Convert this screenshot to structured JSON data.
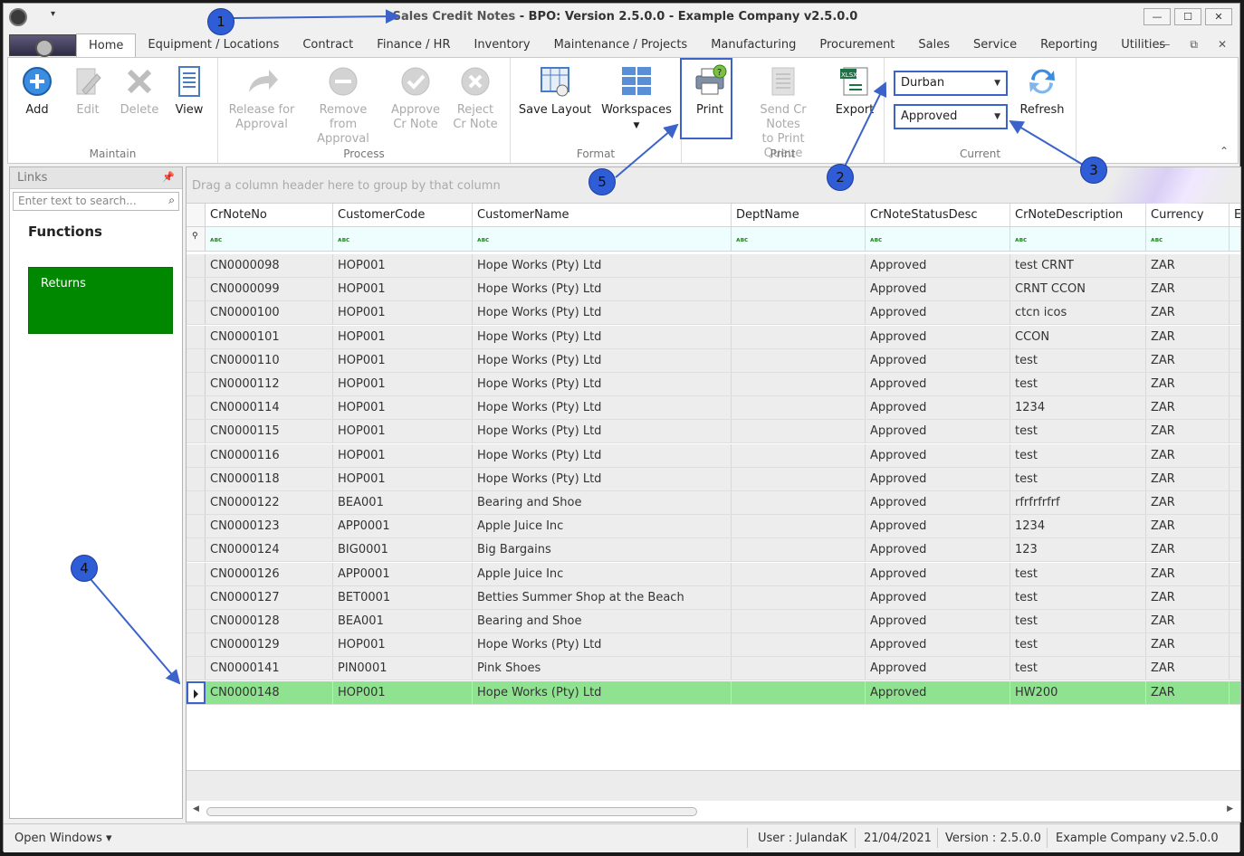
{
  "title": {
    "part1": "Sales Credit Notes",
    "part2": " - BPO: Version 2.5.0.0 - Example Company v2.5.0.0"
  },
  "window_controls": [
    "—",
    "☐",
    "✕"
  ],
  "tabs": [
    "Home",
    "Equipment / Locations",
    "Contract",
    "Finance / HR",
    "Inventory",
    "Maintenance / Projects",
    "Manufacturing",
    "Procurement",
    "Sales",
    "Service",
    "Reporting",
    "Utilities"
  ],
  "tab_controls": [
    "—",
    "⧉",
    "✕"
  ],
  "ribbon": {
    "maintain": {
      "label": "Maintain",
      "add": "Add",
      "edit": "Edit",
      "delete": "Delete",
      "view": "View"
    },
    "process": {
      "label": "Process",
      "release_1": "Release for",
      "release_2": "Approval",
      "remove_1": "Remove from",
      "remove_2": "Approval",
      "approve_1": "Approve",
      "approve_2": "Cr Note",
      "reject_1": "Reject",
      "reject_2": "Cr Note"
    },
    "format": {
      "label": "Format",
      "save_layout": "Save Layout",
      "workspaces": "Workspaces"
    },
    "print": {
      "label": "Print",
      "print": "Print",
      "send_1": "Send Cr Notes",
      "send_2": "to Print Queue",
      "export": "Export"
    },
    "current": {
      "label": "Current",
      "site": "Durban",
      "status": "Approved",
      "refresh": "Refresh"
    }
  },
  "links": {
    "title": "Links",
    "search_placeholder": "Enter text to search...",
    "functions": "Functions",
    "returns": "Returns"
  },
  "grid": {
    "group_hint": "Drag a column header here to group by that column",
    "columns": [
      "CrNoteNo",
      "CustomerCode",
      "CustomerName",
      "DeptName",
      "CrNoteStatusDesc",
      "CrNoteDescription",
      "Currency",
      "E"
    ],
    "rows": [
      [
        "CN0000098",
        "HOP001",
        "Hope Works (Pty) Ltd",
        "",
        "Approved",
        "test CRNT",
        "ZAR"
      ],
      [
        "CN0000099",
        "HOP001",
        "Hope Works (Pty) Ltd",
        "",
        "Approved",
        "CRNT CCON",
        "ZAR"
      ],
      [
        "CN0000100",
        "HOP001",
        "Hope Works (Pty) Ltd",
        "",
        "Approved",
        "ctcn icos",
        "ZAR"
      ],
      [
        "CN0000101",
        "HOP001",
        "Hope Works (Pty) Ltd",
        "",
        "Approved",
        "CCON",
        "ZAR"
      ],
      [
        "CN0000110",
        "HOP001",
        "Hope Works (Pty) Ltd",
        "",
        "Approved",
        "test",
        "ZAR"
      ],
      [
        "CN0000112",
        "HOP001",
        "Hope Works (Pty) Ltd",
        "",
        "Approved",
        "test",
        "ZAR"
      ],
      [
        "CN0000114",
        "HOP001",
        "Hope Works (Pty) Ltd",
        "",
        "Approved",
        "1234",
        "ZAR"
      ],
      [
        "CN0000115",
        "HOP001",
        "Hope Works (Pty) Ltd",
        "",
        "Approved",
        "test",
        "ZAR"
      ],
      [
        "CN0000116",
        "HOP001",
        "Hope Works (Pty) Ltd",
        "",
        "Approved",
        "test",
        "ZAR"
      ],
      [
        "CN0000118",
        "HOP001",
        "Hope Works (Pty) Ltd",
        "",
        "Approved",
        "test",
        "ZAR"
      ],
      [
        "CN0000122",
        "BEA001",
        "Bearing and Shoe",
        "",
        "Approved",
        "rfrfrfrfrf",
        "ZAR"
      ],
      [
        "CN0000123",
        "APP0001",
        "Apple Juice Inc",
        "",
        "Approved",
        "1234",
        "ZAR"
      ],
      [
        "CN0000124",
        "BIG0001",
        "Big Bargains",
        "",
        "Approved",
        "123",
        "ZAR"
      ],
      [
        "CN0000126",
        "APP0001",
        "Apple Juice Inc",
        "",
        "Approved",
        "test",
        "ZAR"
      ],
      [
        "CN0000127",
        "BET0001",
        "Betties Summer Shop at the Beach",
        "",
        "Approved",
        "test",
        "ZAR"
      ],
      [
        "CN0000128",
        "BEA001",
        "Bearing and Shoe",
        "",
        "Approved",
        "test",
        "ZAR"
      ],
      [
        "CN0000129",
        "HOP001",
        "Hope Works (Pty) Ltd",
        "",
        "Approved",
        "test",
        "ZAR"
      ],
      [
        "CN0000141",
        "PIN0001",
        "Pink Shoes",
        "",
        "Approved",
        "test",
        "ZAR"
      ],
      [
        "CN0000148",
        "HOP001",
        "Hope Works (Pty) Ltd",
        "",
        "Approved",
        "HW200",
        "ZAR"
      ]
    ],
    "selected_row": 18
  },
  "statusbar": {
    "open_windows": "Open Windows ▾",
    "user": "User : JulandaK",
    "date": "21/04/2021",
    "version": "Version : 2.5.0.0",
    "company": "Example Company v2.5.0.0"
  },
  "callouts": [
    "1",
    "2",
    "3",
    "4",
    "5"
  ],
  "colors": {
    "accent": "#2f5dd6",
    "selected_row": "#8fe28f",
    "returns_tile": "#008800",
    "filter_row": "#eefdfd"
  }
}
